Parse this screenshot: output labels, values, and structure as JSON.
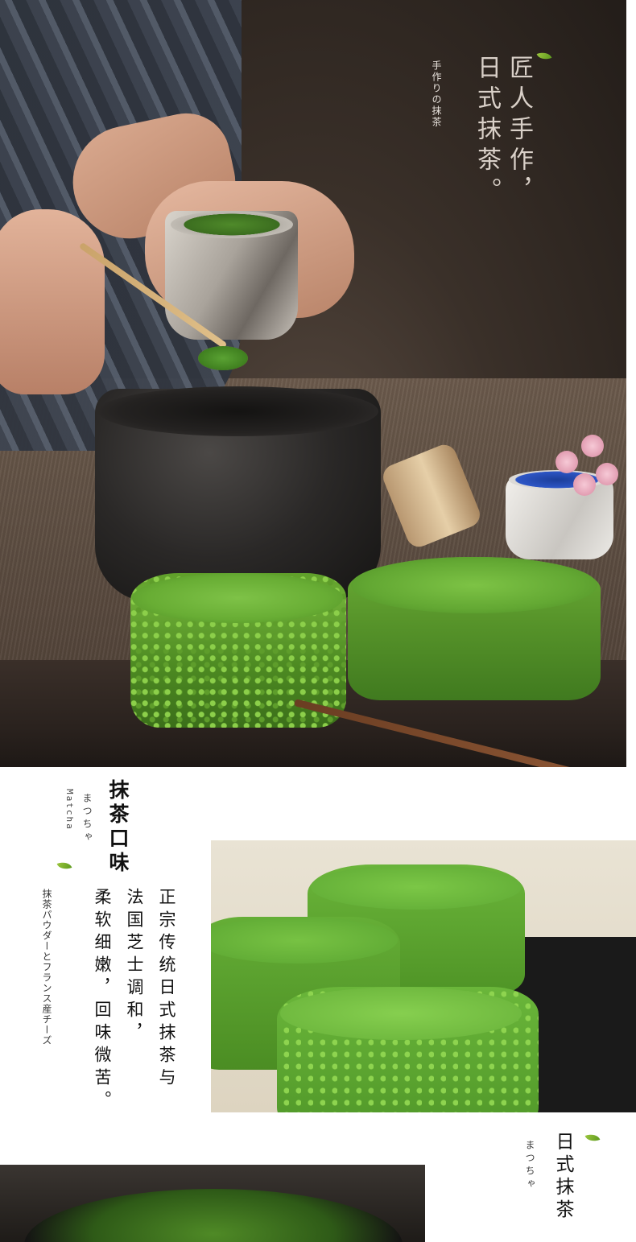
{
  "hero": {
    "small_caption": "手作りの抹茶",
    "title_line1": "匠人手作，",
    "title_line2": "日式抹茶。"
  },
  "section": {
    "title": "抹茶口味",
    "kana": "まつちゃ",
    "latin": "Matcha",
    "side_caption": "抹茶パウダーとフランス産チーズ",
    "description": [
      "正宗传统日式抹茶与",
      "法国芝士调和，",
      "柔软细嫩，回味微苦。"
    ]
  },
  "bottom": {
    "title": "日式抹茶",
    "kana": "まつちゃ"
  },
  "colors": {
    "matcha": "#5fa32f",
    "leaf": "#7fb334",
    "text": "#111111"
  },
  "icons": [
    "leaf-icon"
  ]
}
